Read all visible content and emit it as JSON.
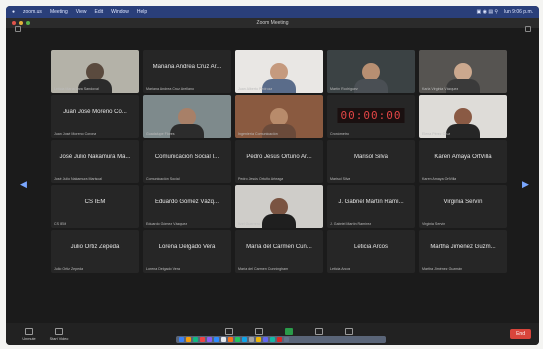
{
  "menubar": {
    "items": [
      "zoom.us",
      "Meeting",
      "View",
      "Edit",
      "Window",
      "Help"
    ],
    "clock": "lun 9:06 p.m."
  },
  "window": {
    "title": "Zoom Meeting"
  },
  "tiles": [
    {
      "type": "video",
      "small": "Leticia María Lara Sandoval",
      "bg": "#b4b2a8",
      "skin": "#5a4a3e",
      "shirt": "#2b2b2b"
    },
    {
      "type": "name",
      "name": "Mariana Andrea Cruz Ar...",
      "small": "Mariana Andrea Cruz Arellano"
    },
    {
      "type": "video",
      "small": "Juan Alberto Pedroza",
      "bg": "#e9e7e4",
      "skin": "#c59a7e",
      "shirt": "#5a6c8a"
    },
    {
      "type": "video",
      "small": "Martín Rodríguez",
      "bg": "#3b4244",
      "skin": "#b78f72",
      "shirt": "#4a4f54"
    },
    {
      "type": "video",
      "small": "Karla Virginia Vázquez",
      "bg": "#565451",
      "skin": "#cba88e",
      "shirt": "#3a3a3a"
    },
    {
      "type": "name",
      "name": "Juan José Moreno Co...",
      "small": "Juan José Moreno Corona"
    },
    {
      "type": "video",
      "small": "Guadalupe Flores",
      "bg": "#7e8a8c",
      "skin": "#a88068",
      "shirt": "#2c2c2c"
    },
    {
      "type": "video",
      "small": "Ingeniería Comunicación",
      "bg": "#8a5a40",
      "skin": "#b88b6b",
      "shirt": "#6a4a3a"
    },
    {
      "type": "clock",
      "clock": "00:00:00",
      "small": "Cronómetro"
    },
    {
      "type": "video",
      "small": "Elena Pérez Cruz",
      "bg": "#dedcd8",
      "skin": "#8a5a44",
      "shirt": "#262626"
    },
    {
      "type": "name",
      "name": "José Julio Nakamura Ma...",
      "small": "José Julio Nakamura Mariscal"
    },
    {
      "type": "name",
      "name": "Comunicación Social I...",
      "small": "Comunicación Social"
    },
    {
      "type": "name",
      "name": "Pedro Jesús Ortuño Ar...",
      "small": "Pedro Jesús Ortuño Arteaga"
    },
    {
      "type": "name",
      "name": "Marisol Silva",
      "small": "Marisol Silva"
    },
    {
      "type": "name",
      "name": "Karen Amaya OrtVilla",
      "small": "Karen Amaya OrtVilla"
    },
    {
      "type": "name",
      "name": "CS IEM",
      "small": "CS IEM"
    },
    {
      "type": "name",
      "name": "Eduardo Gómez Vázq...",
      "small": "Eduardo Gómez Vázquez"
    },
    {
      "type": "video",
      "small": "Itzel Guerrero",
      "bg": "#cfcdc9",
      "skin": "#7a5442",
      "shirt": "#1f1f1f"
    },
    {
      "type": "name",
      "name": "J. Gabriel Martín Ramí...",
      "small": "J. Gabriel Martín Ramírez"
    },
    {
      "type": "name",
      "name": "Virginia Servín",
      "small": "Virginia Servín"
    },
    {
      "type": "name",
      "name": "Julio Ortiz Zepeda",
      "small": "Julio Ortiz Zepeda"
    },
    {
      "type": "name",
      "name": "Lorena Delgado Vera",
      "small": "Lorena Delgado Vera"
    },
    {
      "type": "name",
      "name": "María del Carmen Cun...",
      "small": "María del Carmen Cunningham"
    },
    {
      "type": "name",
      "name": "Leticia Arcos",
      "small": "Leticia Arcos"
    },
    {
      "type": "name",
      "name": "Martha Jiménez Guzm...",
      "small": "Martha Jiménez Guzmán"
    }
  ],
  "controls": [
    {
      "label": "Unmute"
    },
    {
      "label": "Start Video"
    },
    {
      "label": "Participants"
    },
    {
      "label": "Chat"
    },
    {
      "label": "Share Screen"
    },
    {
      "label": "Record"
    },
    {
      "label": "Reactions"
    }
  ],
  "end_label": "End",
  "colors": {
    "share": "#2a9b4a",
    "end": "#d9453b",
    "menubar": "#2a3f7a"
  }
}
